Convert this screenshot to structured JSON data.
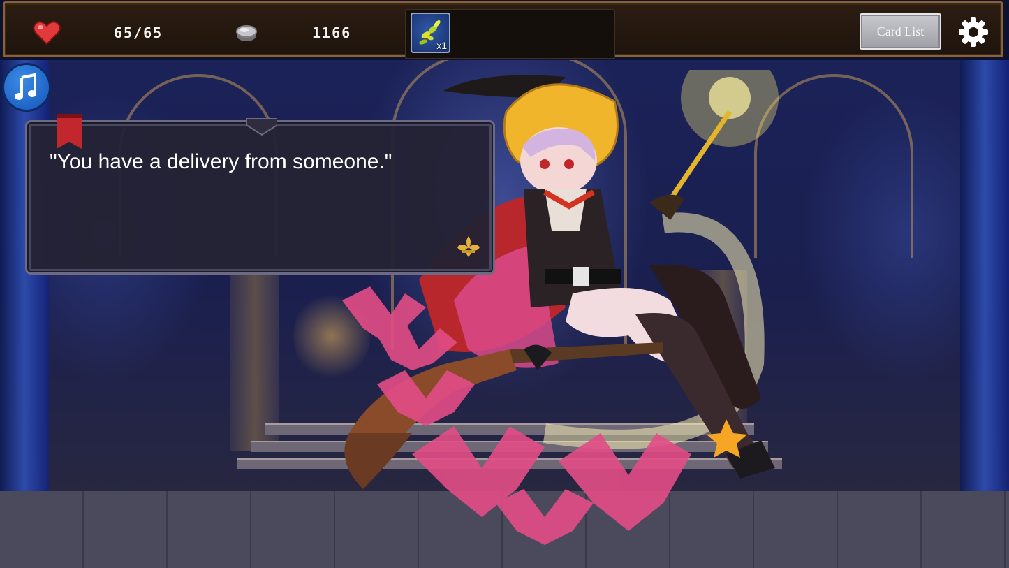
{
  "stats": {
    "hp": "65/65",
    "coins": "1166"
  },
  "inventory": {
    "items": [
      {
        "icon": "herb-icon",
        "count": "x1"
      }
    ]
  },
  "buttons": {
    "card_list": "Card List"
  },
  "dialog": {
    "text": "\"You have a delivery from someone.\""
  },
  "colors": {
    "topbar": "#2c1d12",
    "topbar_border": "#8a6238",
    "dialog_bg": "#242234",
    "music_button": "#1d6cd0",
    "heart": "#e23a3a"
  }
}
